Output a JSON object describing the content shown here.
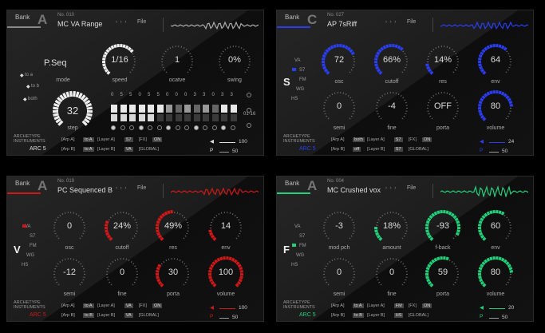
{
  "panels": [
    {
      "id": "A1",
      "bank": "Bank",
      "letter": "A",
      "no": "No. 010",
      "name": "MC VA Range",
      "nav": "‹ › ›",
      "file": "File",
      "accent": "#888888",
      "knobs": [
        {
          "value": "P.Seq",
          "label": "mode",
          "fill": 0
        },
        {
          "value": "1/16",
          "label": "speed",
          "fill": 0.7
        },
        {
          "value": "1",
          "label": "ocatve",
          "fill": 0
        },
        {
          "value": "0%",
          "label": "swing",
          "fill": 0
        },
        {
          "value": "32",
          "label": "step",
          "fill": 1
        }
      ],
      "selector": {
        "options": [
          "to a",
          "to b",
          "both"
        ],
        "main": ""
      },
      "seq": {
        "nums": [
          "0",
          "5",
          "5",
          "0",
          "5",
          "5",
          "0",
          "0",
          "0",
          "3",
          "3",
          "0",
          "3",
          "3"
        ],
        "range": "01-16"
      },
      "footer": {
        "line1": "ARCHETYPE",
        "line2": "INSTRUMENTS",
        "arc": "ARC 5",
        "r1": [
          "[Arp A]",
          "to A",
          "[Layer A]",
          "S7",
          "[FX]",
          "ON"
        ],
        "r2": [
          "[Arp B]",
          "to A",
          "[Layer B]",
          "VA",
          "[GLOBAL]"
        ],
        "lvl1": "100",
        "lvl2": "50",
        "p": "P"
      }
    },
    {
      "id": "C",
      "bank": "Bank",
      "letter": "C",
      "no": "No. 027",
      "name": "AP 7sRiff",
      "nav": "‹ › ›",
      "file": "File",
      "accent": "#2a3ef0",
      "knobs": [
        {
          "value": "72",
          "label": "osc",
          "fill": 0.72
        },
        {
          "value": "66%",
          "label": "cutoff",
          "fill": 0.66
        },
        {
          "value": "14%",
          "label": "res",
          "fill": 0.14
        },
        {
          "value": "64",
          "label": "env",
          "fill": 0.64
        },
        {
          "value": "0",
          "label": "semi",
          "fill": 0
        },
        {
          "value": "-4",
          "label": "fine",
          "fill": 0
        },
        {
          "value": "OFF",
          "label": "porta",
          "fill": 0
        },
        {
          "value": "80",
          "label": "volume",
          "fill": 0.8
        }
      ],
      "selector": {
        "options": [
          "VA",
          "S7",
          "FM",
          "WG",
          "HS"
        ],
        "main": "S"
      },
      "footer": {
        "line1": "ARCHETYPE",
        "line2": "INSTRUMENTS",
        "arc": "ARC 5",
        "r1": [
          "[Arp A]",
          "both",
          "[Layer A]",
          "S7",
          "[FX]",
          "ON"
        ],
        "r2": [
          "[Arp B]",
          "off",
          "[Layer B]",
          "S7",
          "[GLOBAL]"
        ],
        "lvl1": "24",
        "lvl2": "50",
        "p": "P"
      }
    },
    {
      "id": "A2",
      "bank": "Bank",
      "letter": "A",
      "no": "No. 019",
      "name": "PC Sequenced B",
      "nav": "‹ › ›",
      "file": "File",
      "accent": "#d01818",
      "knobs": [
        {
          "value": "0",
          "label": "osc",
          "fill": 0
        },
        {
          "value": "24%",
          "label": "cutoff",
          "fill": 0.24
        },
        {
          "value": "49%",
          "label": "res",
          "fill": 0.49
        },
        {
          "value": "14",
          "label": "env",
          "fill": 0.14
        },
        {
          "value": "-12",
          "label": "semi",
          "fill": 0
        },
        {
          "value": "0",
          "label": "fine",
          "fill": 0
        },
        {
          "value": "30",
          "label": "porta",
          "fill": 0.3
        },
        {
          "value": "100",
          "label": "volume",
          "fill": 1
        }
      ],
      "selector": {
        "options": [
          "VA",
          "S7",
          "FM",
          "WG",
          "HS"
        ],
        "main": "V"
      },
      "footer": {
        "line1": "ARCHETYPE",
        "line2": "INSTRUMENTS",
        "arc": "ARC 5",
        "r1": [
          "[Arp A]",
          "to A",
          "[Layer A]",
          "VA",
          "[FX]",
          "ON"
        ],
        "r2": [
          "[Arp B]",
          "to B",
          "[Layer B]",
          "VA",
          "[GLOBAL]"
        ],
        "lvl1": "100",
        "lvl2": "50",
        "p": "P"
      }
    },
    {
      "id": "A3",
      "bank": "Bank",
      "letter": "A",
      "no": "No. 004",
      "name": "MC Crushed vox",
      "nav": "‹ › ›",
      "file": "File",
      "accent": "#22d07a",
      "knobs": [
        {
          "value": "-3",
          "label": "mod pch",
          "fill": 0
        },
        {
          "value": "18%",
          "label": "amount",
          "fill": 0.18
        },
        {
          "value": "-93",
          "label": "f-back",
          "fill": 0.93
        },
        {
          "value": "60",
          "label": "env",
          "fill": 0.6
        },
        {
          "value": "0",
          "label": "semi",
          "fill": 0
        },
        {
          "value": "0",
          "label": "fine",
          "fill": 0
        },
        {
          "value": "59",
          "label": "porta",
          "fill": 0.59
        },
        {
          "value": "80",
          "label": "volume",
          "fill": 0.8
        }
      ],
      "selector": {
        "options": [
          "VA",
          "S7",
          "FM",
          "WG",
          "HS"
        ],
        "main": "F"
      },
      "footer": {
        "line1": "ARCHETYPE",
        "line2": "INSTRUMENTS",
        "arc": "ARC 5",
        "r1": [
          "[Arp A]",
          "to A",
          "[Layer A]",
          "FM",
          "[FX]",
          "ON"
        ],
        "r2": [
          "[Arp B]",
          "to B",
          "[Layer B]",
          "HS",
          "[GLOBAL]"
        ],
        "lvl1": "20",
        "lvl2": "50",
        "p": "P"
      }
    }
  ]
}
